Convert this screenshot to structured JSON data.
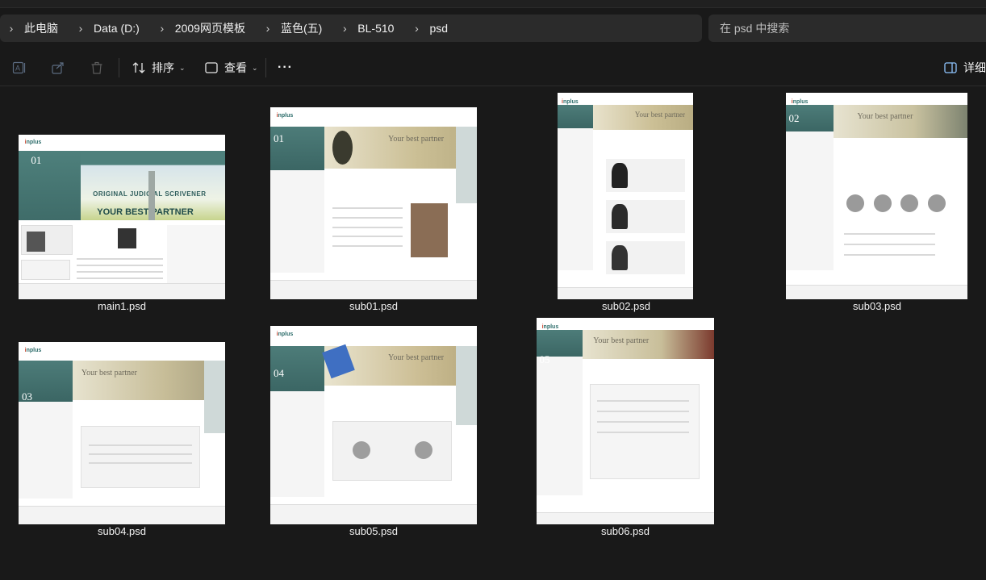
{
  "breadcrumb": [
    "此电脑",
    "Data (D:)",
    "2009网页模板",
    "蓝色(五)",
    "BL-510",
    "psd"
  ],
  "search": {
    "placeholder": "在 psd 中搜索"
  },
  "toolbar": {
    "sort_label": "排序",
    "view_label": "查看",
    "more_label": "···",
    "details_label": "详细"
  },
  "files": [
    {
      "name": "main1.psd"
    },
    {
      "name": "sub01.psd"
    },
    {
      "name": "sub02.psd"
    },
    {
      "name": "sub03.psd"
    },
    {
      "name": "sub04.psd"
    },
    {
      "name": "sub05.psd"
    },
    {
      "name": "sub06.psd"
    }
  ],
  "thumb_text": {
    "your_best_partner": "Your best partner",
    "main_sub": "ORIGINAL JUDICIAL SCRIVENER",
    "main_title": "YOUR BEST PARTNER",
    "logo_prefix": "i",
    "logo_rest": "nplus",
    "n1": "01",
    "n2": "02",
    "n3": "03",
    "n4": "04",
    "n5": "05"
  },
  "colors": {
    "background": "#191919",
    "panel": "#2b2b2b",
    "accent": "#4e807c"
  }
}
